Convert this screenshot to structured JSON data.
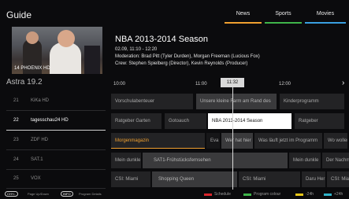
{
  "header": {
    "title": "Guide"
  },
  "tabs": [
    {
      "label": "News",
      "color": "#f0a030"
    },
    {
      "label": "Sports",
      "color": "#3fb54a"
    },
    {
      "label": "Movies",
      "color": "#3a9fe0"
    }
  ],
  "preview": {
    "channel_label": "14 PHOENIX HD"
  },
  "program_info": {
    "title": "NBA 2013-2014 Season",
    "time": "02.09, 11:10 - 12:20",
    "moderation": "Moderation: Brad Pitt (Tyler Durden), Morgan Freeman (Lucious Fox)",
    "crew": "Crew: Stephen Spielberg (Director), Kevin Reynolds (Producer)"
  },
  "channel_group": "Astra 19.2",
  "timeline": {
    "t1": "10:00",
    "t2": "11:00",
    "now": "11:32",
    "t3": "12:00"
  },
  "channels": [
    {
      "num": "21",
      "name": "KiKa HD",
      "programs": [
        "Vorschulabenteuer",
        "Unsere kleine Farm am Rand des",
        "Kinderprogramm"
      ]
    },
    {
      "num": "22",
      "name": "tagesschau24 HD",
      "programs": [
        "Ratgeber Garten",
        "Gotoauch",
        "NBA 2013-2014 Season",
        "Ratgeber"
      ]
    },
    {
      "num": "23",
      "name": "ZDF HD",
      "programs": [
        "Morgenmagazin",
        "Eva",
        "Wer hat hier",
        "Was läuft jetzt im Programm",
        "Wo wollen"
      ]
    },
    {
      "num": "24",
      "name": "SAT.1",
      "programs": [
        "Mein dunkle",
        "SAT1-Frühstücksfernsehen",
        "Mein dunkle",
        "Der Nachm"
      ]
    },
    {
      "num": "25",
      "name": "VOX",
      "programs": [
        "CSI: Miami",
        "Shopping Queen",
        "CSI: Miami",
        "Daru Her",
        "CSI: Miam"
      ]
    }
  ],
  "footer": {
    "chan_pill": "CH+/-",
    "chan_text": "Page Up/Down",
    "info_pill": "INFO",
    "info_text": "Program Details",
    "legend": [
      {
        "label": "Schedule",
        "color": "#d9262c"
      },
      {
        "label": "Program colour",
        "color": "#3fb54a"
      },
      {
        "label": "-24h",
        "color": "#e6c619"
      },
      {
        "label": "+24h",
        "color": "#2fb3c9"
      }
    ]
  }
}
